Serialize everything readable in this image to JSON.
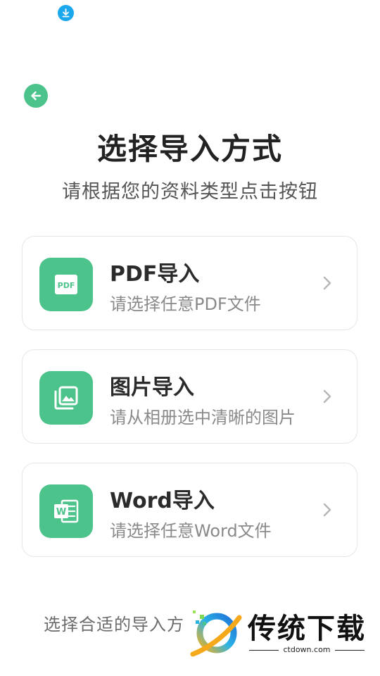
{
  "status_bar": {
    "download_icon": "download-icon"
  },
  "header": {
    "back_icon": "arrow-left-icon",
    "title": "选择导入方式",
    "subtitle": "请根据您的资料类型点击按钮"
  },
  "options": [
    {
      "title": "PDF导入",
      "desc": "请选择任意PDF文件",
      "icon": "pdf-icon",
      "icon_text": "PDF"
    },
    {
      "title": "图片导入",
      "desc": "请从相册选中清晰的图片",
      "icon": "image-gallery-icon"
    },
    {
      "title": "Word导入",
      "desc": "请选择任意Word文件",
      "icon": "word-icon",
      "icon_text": "W"
    }
  ],
  "footer": {
    "text": "选择合适的导入方"
  },
  "watermark": {
    "brand": "传统下载",
    "url": "ctdown.com"
  },
  "colors": {
    "accent": "#4cc38a",
    "download_blue": "#1aa7ec",
    "card_border": "#e6e6e6"
  }
}
